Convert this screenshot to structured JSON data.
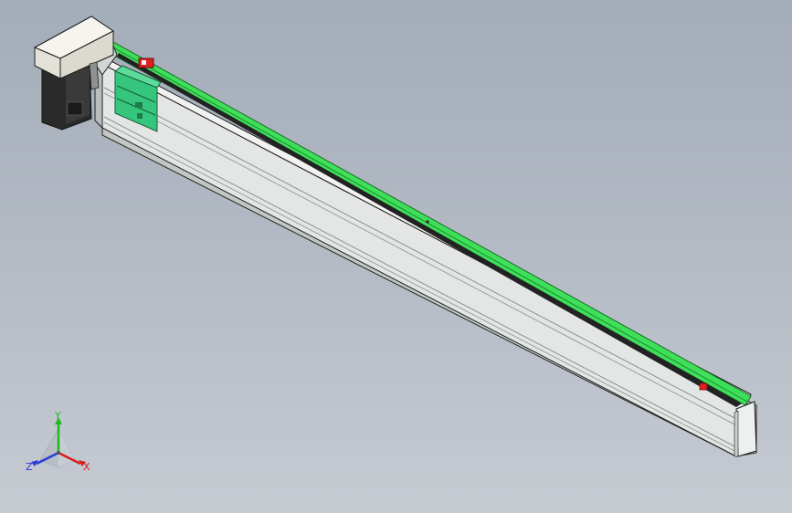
{
  "triad": {
    "x_label": "X",
    "y_label": "Y",
    "z_label": "Z",
    "x_color": "#d81e1e",
    "y_color": "#1fb81f",
    "z_color": "#2a3bd6"
  },
  "colors": {
    "background_top": "#a3acb9",
    "background_bottom": "#c6cbd2",
    "profile_body": "#dfe2e0",
    "profile_shadow": "#b9bebd",
    "cover_strip": "#3ee05a",
    "motor_body": "#2a2a2a",
    "motor_cover": "#e8e6dc",
    "carriage": "#34c27a",
    "sensor": "#e02020"
  }
}
